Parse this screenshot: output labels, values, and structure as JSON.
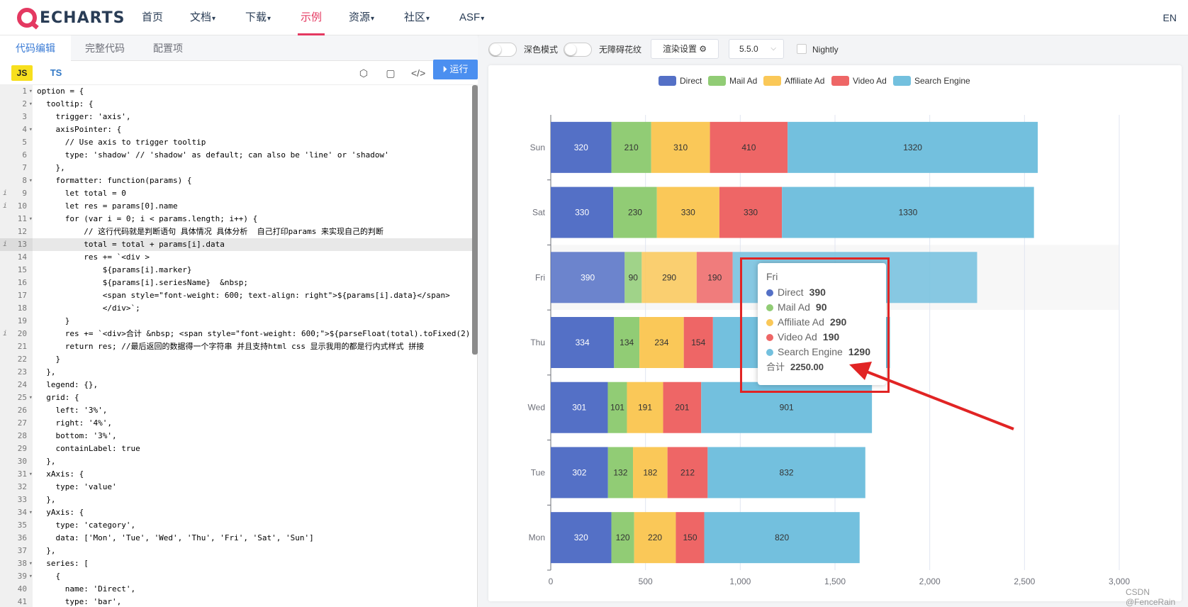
{
  "nav": {
    "logo_text": "ECHARTS",
    "items": [
      {
        "label": "首页",
        "caret": ""
      },
      {
        "label": "文档",
        "caret": "▾"
      },
      {
        "label": "下载",
        "caret": "▾"
      },
      {
        "label": "示例",
        "caret": ""
      },
      {
        "label": "资源",
        "caret": "▾"
      },
      {
        "label": "社区",
        "caret": "▾"
      },
      {
        "label": "ASF",
        "caret": "▾"
      }
    ],
    "lang": "EN"
  },
  "editor": {
    "tabs": [
      "代码编辑",
      "完整代码",
      "配置项"
    ],
    "js_label": "JS",
    "ts_label": "TS",
    "run_label": "运行",
    "lines": [
      {
        "n": "1",
        "fold": true,
        "info": false,
        "text": "option = {"
      },
      {
        "n": "2",
        "fold": true,
        "info": false,
        "text": "  tooltip: {"
      },
      {
        "n": "3",
        "fold": false,
        "info": false,
        "text": "    trigger: 'axis',"
      },
      {
        "n": "4",
        "fold": true,
        "info": false,
        "text": "    axisPointer: {"
      },
      {
        "n": "5",
        "fold": false,
        "info": false,
        "text": "      // Use axis to trigger tooltip"
      },
      {
        "n": "6",
        "fold": false,
        "info": false,
        "text": "      type: 'shadow' // 'shadow' as default; can also be 'line' or 'shadow'"
      },
      {
        "n": "7",
        "fold": false,
        "info": false,
        "text": "    },"
      },
      {
        "n": "8",
        "fold": true,
        "info": false,
        "text": "    formatter: function(params) {"
      },
      {
        "n": "9",
        "fold": false,
        "info": true,
        "text": "      let total = 0"
      },
      {
        "n": "10",
        "fold": false,
        "info": true,
        "text": "      let res = params[0].name"
      },
      {
        "n": "11",
        "fold": true,
        "info": false,
        "text": "      for (var i = 0; i < params.length; i++) {"
      },
      {
        "n": "12",
        "fold": false,
        "info": false,
        "text": "          // 这行代码就是判断语句 具体情况 具体分析  自己打印params 来实现自己的判断"
      },
      {
        "n": "13",
        "fold": false,
        "info": true,
        "text": "          total = total + params[i].data"
      },
      {
        "n": "14",
        "fold": false,
        "info": false,
        "text": "          res += `<div >"
      },
      {
        "n": "15",
        "fold": false,
        "info": false,
        "text": "              ${params[i].marker}"
      },
      {
        "n": "16",
        "fold": false,
        "info": false,
        "text": "              ${params[i].seriesName}  &nbsp;"
      },
      {
        "n": "17",
        "fold": false,
        "info": false,
        "text": "              <span style=\"font-weight: 600; text-align: right\">${params[i].data}</span>"
      },
      {
        "n": "18",
        "fold": false,
        "info": false,
        "text": "              </div>`;"
      },
      {
        "n": "19",
        "fold": false,
        "info": false,
        "text": "      }"
      },
      {
        "n": "20",
        "fold": false,
        "info": true,
        "text": "      res += `<div>合计 &nbsp; <span style=\"font-weight: 600;\">${parseFloat(total).toFixed(2)"
      },
      {
        "n": "21",
        "fold": false,
        "info": false,
        "text": "      return res; //最后返回的数据得一个字符串 并且支持html css 显示我用的都是行内式样式 拼接"
      },
      {
        "n": "22",
        "fold": false,
        "info": false,
        "text": "    }"
      },
      {
        "n": "23",
        "fold": false,
        "info": false,
        "text": "  },"
      },
      {
        "n": "24",
        "fold": false,
        "info": false,
        "text": "  legend: {},"
      },
      {
        "n": "25",
        "fold": true,
        "info": false,
        "text": "  grid: {"
      },
      {
        "n": "26",
        "fold": false,
        "info": false,
        "text": "    left: '3%',"
      },
      {
        "n": "27",
        "fold": false,
        "info": false,
        "text": "    right: '4%',"
      },
      {
        "n": "28",
        "fold": false,
        "info": false,
        "text": "    bottom: '3%',"
      },
      {
        "n": "29",
        "fold": false,
        "info": false,
        "text": "    containLabel: true"
      },
      {
        "n": "30",
        "fold": false,
        "info": false,
        "text": "  },"
      },
      {
        "n": "31",
        "fold": true,
        "info": false,
        "text": "  xAxis: {"
      },
      {
        "n": "32",
        "fold": false,
        "info": false,
        "text": "    type: 'value'"
      },
      {
        "n": "33",
        "fold": false,
        "info": false,
        "text": "  },"
      },
      {
        "n": "34",
        "fold": true,
        "info": false,
        "text": "  yAxis: {"
      },
      {
        "n": "35",
        "fold": false,
        "info": false,
        "text": "    type: 'category',"
      },
      {
        "n": "36",
        "fold": false,
        "info": false,
        "text": "    data: ['Mon', 'Tue', 'Wed', 'Thu', 'Fri', 'Sat', 'Sun']"
      },
      {
        "n": "37",
        "fold": false,
        "info": false,
        "text": "  },"
      },
      {
        "n": "38",
        "fold": true,
        "info": false,
        "text": "  series: ["
      },
      {
        "n": "39",
        "fold": true,
        "info": false,
        "text": "    {"
      },
      {
        "n": "40",
        "fold": false,
        "info": false,
        "text": "      name: 'Direct',"
      },
      {
        "n": "41",
        "fold": false,
        "info": false,
        "text": "      type: 'bar',"
      }
    ]
  },
  "controls": {
    "dark_mode_label": "深色模式",
    "a11y_label": "无障碍花纹",
    "render_label": "渲染设置 ⚙",
    "version": "5.5.0",
    "nightly_label": "Nightly"
  },
  "tooltip": {
    "title": "Fri",
    "total_label": "合计",
    "total_value": "2250.00"
  },
  "watermark": "CSDN @FenceRain",
  "colors": {
    "accent": "#e43961",
    "Direct": "#5470c6",
    "Mail Ad": "#91cc75",
    "Affiliate Ad": "#fac858",
    "Video Ad": "#ee6666",
    "Search Engine": "#73c0de",
    "annotation": "#e12424"
  },
  "chart_data": {
    "type": "bar",
    "orientation": "horizontal",
    "stacked": true,
    "categories": [
      "Mon",
      "Tue",
      "Wed",
      "Thu",
      "Fri",
      "Sat",
      "Sun"
    ],
    "series": [
      {
        "name": "Direct",
        "values": [
          320,
          302,
          301,
          334,
          390,
          330,
          320
        ]
      },
      {
        "name": "Mail Ad",
        "values": [
          120,
          132,
          101,
          134,
          90,
          230,
          210
        ]
      },
      {
        "name": "Affiliate Ad",
        "values": [
          220,
          182,
          191,
          234,
          290,
          330,
          310
        ]
      },
      {
        "name": "Video Ad",
        "values": [
          150,
          212,
          201,
          154,
          190,
          330,
          410
        ]
      },
      {
        "name": "Search Engine",
        "values": [
          820,
          832,
          901,
          934,
          1290,
          1330,
          1320
        ]
      }
    ],
    "xlim": [
      0,
      3000
    ],
    "x_ticks": [
      "0",
      "500",
      "1,000",
      "1,500",
      "2,000",
      "2,500",
      "3,000"
    ],
    "grid": true,
    "legend_position": "top-center",
    "highlighted_category": "Fri"
  }
}
